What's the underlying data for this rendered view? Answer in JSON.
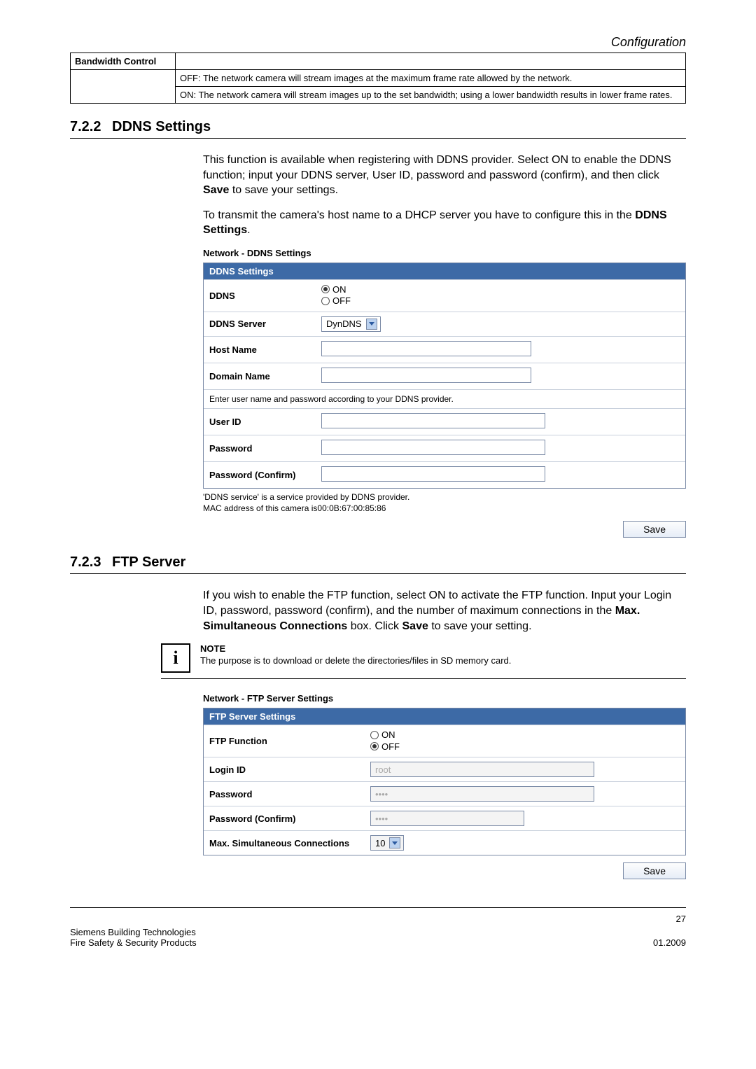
{
  "header": {
    "category": "Configuration"
  },
  "bandwidth": {
    "label": "Bandwidth Control",
    "off_text": "OFF: The network camera will stream images at the maximum frame rate allowed by the network.",
    "on_text": "ON: The network camera will stream images up to the set bandwidth; using a lower bandwidth results in lower frame rates."
  },
  "sec_ddns": {
    "num": "7.2.2",
    "title": "DDNS Settings",
    "para1_a": "This function is available when registering with DDNS provider. Select ON to enable the DDNS function; input your DDNS server, User ID, password and password (confirm), and then click ",
    "para1_b": "Save",
    "para1_c": " to save your settings.",
    "para2_a": "To transmit the camera's host name to a DHCP server you have to configure this in the ",
    "para2_b": "DDNS Settings",
    "para2_c": ".",
    "panel_title": "Network - DDNS Settings",
    "panel_header": "DDNS Settings",
    "row_ddns": "DDNS",
    "opt_on": "ON",
    "opt_off": "OFF",
    "row_server": "DDNS Server",
    "server_value": "DynDNS",
    "row_host": "Host Name",
    "row_domain": "Domain Name",
    "hint": "Enter user name and password according to your DDNS provider.",
    "row_user": "User ID",
    "row_pwd": "Password",
    "row_pwdc": "Password (Confirm)",
    "foot1": "'DDNS service' is a service provided by DDNS provider.",
    "foot2": "MAC address of this camera is00:0B:67:00:85:86",
    "save": "Save"
  },
  "sec_ftp": {
    "num": "7.2.3",
    "title": "FTP Server",
    "para_a": "If you wish to enable the FTP function, select ON to activate the FTP function. Input your Login ID, password, password (confirm), and the number of maximum connections in the ",
    "para_b": "Max. Simultaneous Connections",
    "para_c": " box. Click ",
    "para_d": "Save",
    "para_e": " to save your setting.",
    "note_label": "NOTE",
    "note_text": "The purpose is to download or delete the directories/files in SD memory card.",
    "panel_title": "Network - FTP Server Settings",
    "panel_header": "FTP Server Settings",
    "row_func": "FTP Function",
    "opt_on": "ON",
    "opt_off": "OFF",
    "row_login": "Login ID",
    "login_value": "root",
    "row_pwd": "Password",
    "pwd_value": "••••",
    "row_pwdc": "Password (Confirm)",
    "pwdc_value": "••••",
    "row_max": "Max. Simultaneous Connections",
    "max_value": "10",
    "save": "Save"
  },
  "footer": {
    "page": "27",
    "line1": "Siemens Building Technologies",
    "line2": "Fire Safety & Security Products",
    "date": "01.2009"
  }
}
